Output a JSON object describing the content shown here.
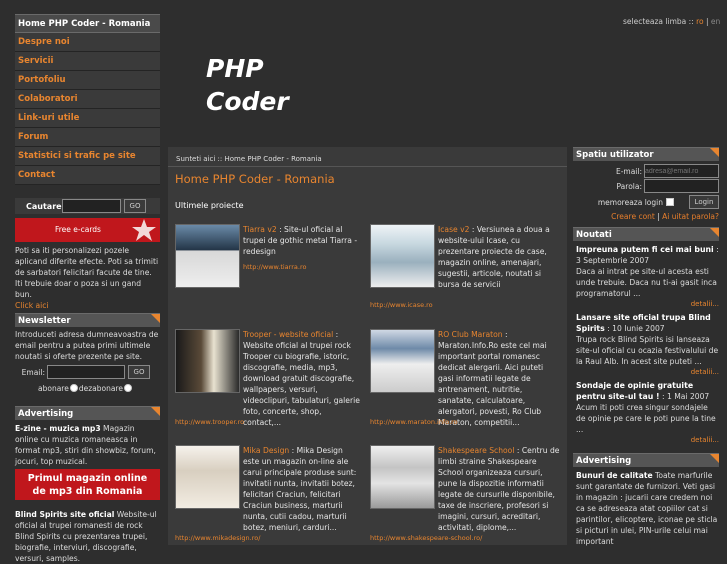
{
  "nav": {
    "items": [
      {
        "label": "Home PHP Coder - Romania",
        "active": true
      },
      {
        "label": "Despre noi"
      },
      {
        "label": "Servicii"
      },
      {
        "label": "Portofoliu"
      },
      {
        "label": "Colaboratori"
      },
      {
        "label": "Link-uri utile"
      },
      {
        "label": "Forum"
      },
      {
        "label": "Statistici si trafic pe site"
      },
      {
        "label": "Contact"
      }
    ]
  },
  "search": {
    "label": "Cautare",
    "button": "GO"
  },
  "ecards": {
    "banner": "Free e-cards",
    "text": "Poti sa iti personalizezi pozele aplicand diferite efecte. Poti sa trimiti de sarbatori felicitari facute de tine. Iti trebuie doar o poza si un gand bun.",
    "link": "Click aici"
  },
  "newsletter": {
    "title": "Newsletter",
    "text": "Introduceti adresa dumneavoastra de email pentru a putea primi ultimele noutati si oferte prezente pe site.",
    "email_label": "Email:",
    "button": "GO",
    "subscribe": "abonare",
    "unsubscribe": "dezabonare"
  },
  "advertising_left": {
    "title": "Advertising",
    "item1_title": "E-zine - muzica mp3",
    "item1_text": " Magazin online cu muzica romaneasca in format mp3, stiri din showbiz, forum, jocuri, top muzical.",
    "banner_line1": "Primul magazin online",
    "banner_line2": "de mp3 din Romania",
    "item2_title": "Blind Spirits site oficial",
    "item2_text": " Website-ul oficial al trupei romanesti de rock Blind Spirits cu prezentarea trupei, biografie, interviuri, discografie, versuri, samples."
  },
  "header": {
    "language_label": "selecteaza limba ::",
    "lang_ro": "ro",
    "lang_sep": "|",
    "lang_en": "en",
    "logo_line1": "PHP",
    "logo_line2": "Coder"
  },
  "main": {
    "breadcrumb": "Sunteti aici :: Home PHP Coder - Romania",
    "title": "Home PHP Coder - Romania",
    "section": "Ultimele proiecte",
    "projects": [
      {
        "title": "Tiarra v2",
        "desc": " : Site-ul oficial al trupei de gothic metal Tiarra - redesign",
        "url": "http://www.tiarra.ro"
      },
      {
        "title": "Icase v2",
        "desc": " : Versiunea a doua a website-ului Icase, cu prezentare proiecte de case, magazin online, amenajari, sugestii, articole, noutati si bursa de servicii",
        "url": "http://www.icase.ro"
      },
      {
        "title": "Trooper - website oficial",
        "desc": " : Website oficial al trupei rock Trooper cu biografie, istoric, discografie, media, mp3, download gratuit discografie, wallpapers, versuri, videoclipuri, tabulaturi, galerie foto, concerte, shop, contact,...",
        "url": "http://www.trooper.ro"
      },
      {
        "title": "RO Club Maraton",
        "desc": " : Maraton.Info.Ro este cel mai important portal romanesc dedicat alergarii. Aici puteti gasi informatii legate de antrenament, nutritie, sanatate, calculatoare, alergatori, povesti, Ro Club Maraton, competitii...",
        "url": "http://www.maraton.info.ro"
      },
      {
        "title": "Mika Design",
        "desc": " : Mika Design este un magazin on-line ale carui principale produse sunt: invitatii nunta, invitatii botez, felicitari Craciun, felicitari Craciun business, marturii nunta, cutii cadou, marturii botez, meniuri, carduri...",
        "url": "http://www.mikadesign.ro/"
      },
      {
        "title": "Shakespeare School",
        "desc": " : Centru de limbi straine Shakespeare School organizeaza cursuri, pune la dispozitie informatii legate de cursurile disponibile, taxe de inscriere, profesori si imagini, cursuri, acreditari, activitati, diplome,...",
        "url": "http://www.shakespeare-school.ro/"
      }
    ]
  },
  "user": {
    "title": "Spatiu utilizator",
    "email_label": "E-mail:",
    "email_placeholder": "adresa@email.ro",
    "password_label": "Parola:",
    "remember": "memoreaza login",
    "login_button": "Login",
    "create": "Creare cont",
    "sep": "|",
    "forgot": "Ai uitat parola?"
  },
  "news": {
    "title": "Noutati",
    "items": [
      {
        "title": "Impreuna putem fi cei mai buni",
        "date": " : 3 Septembrie 2007",
        "text": "Daca ai intrat pe site-ul acesta esti unde trebuie. Daca nu ti-ai gasit inca programatorul ...",
        "more": "detalii..."
      },
      {
        "title": "Lansare site oficial trupa Blind Spirits",
        "date": " : 10 Iunie 2007",
        "text": "Trupa rock Blind Spirits isi lanseaza site-ul oficial cu ocazia festivalului de la Raul Alb. In acest site puteti ...",
        "more": "detalii..."
      },
      {
        "title": "Sondaje de opinie gratuite pentru site-ul tau !",
        "date": " : 1 Mai 2007",
        "text": "Acum iti poti crea singur sondajele de opinie pe care le poti pune la tine ...",
        "more": "detalii..."
      }
    ]
  },
  "advertising_right": {
    "title": "Advertising",
    "item_title": "Bunuri de calitate",
    "item_text": " Toate marfurile sunt garantate de furnizori. Veti gasi in magazin : jucarii care credem noi ca se adreseaza atat copiilor cat si parintilor, elicoptere, iconae pe sticla si picturi in ulei, PIN-urile celui mai important"
  },
  "colors": {
    "accent": "#e8852f",
    "panel": "#3a3a3a",
    "bg": "#2e2e2e"
  }
}
